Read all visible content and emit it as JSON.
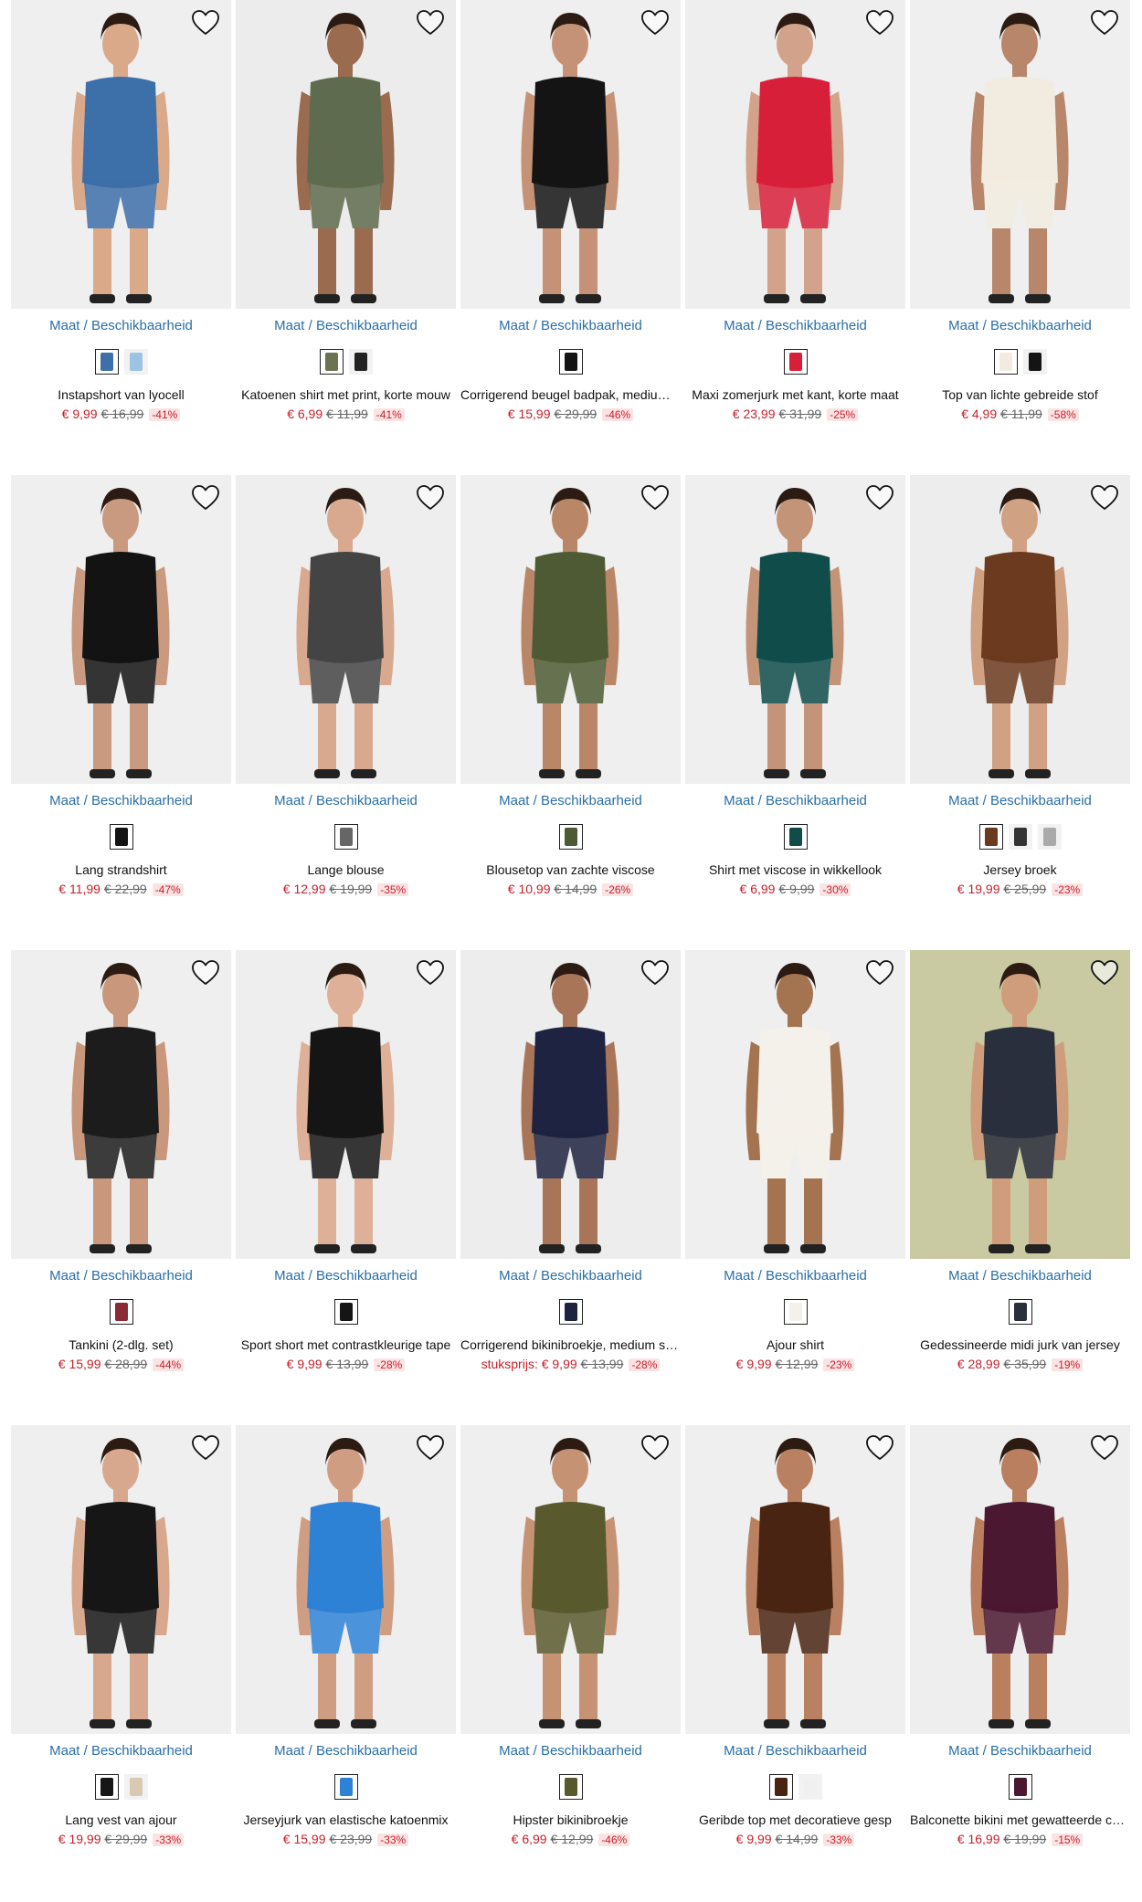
{
  "size_link_label": "Maat / Beschikbaarheid",
  "colors": {
    "accent_link": "#2a6fa6",
    "sale_red": "#c8202b",
    "badge_bg": "#fbe3e4"
  },
  "products": [
    {
      "title": "Instapshort van lyocell",
      "price": "€ 9,99",
      "old_price": "€ 16,99",
      "discount": "-41%",
      "bg": "#efefef",
      "garment": "#3d6fa8",
      "skin": "#d9a98a",
      "swatches": [
        "#3d6fa8",
        "#9cc3e3"
      ]
    },
    {
      "title": "Katoenen shirt met print, korte mouw",
      "price": "€ 6,99",
      "old_price": "€ 11,99",
      "discount": "-41%",
      "bg": "#ececec",
      "garment": "#5f6b4e",
      "skin": "#9a6b4f",
      "swatches": [
        "#6b7350",
        "#222222"
      ]
    },
    {
      "title": "Corrigerend beugel badpak, medium shaping",
      "price": "€ 15,99",
      "old_price": "€ 29,99",
      "discount": "-46%",
      "bg": "#efefef",
      "garment": "#141414",
      "skin": "#c59277",
      "swatches": [
        "#141414"
      ]
    },
    {
      "title": "Maxi zomerjurk met kant, korte maat",
      "price": "€ 23,99",
      "old_price": "€ 31,99",
      "discount": "-25%",
      "bg": "#eeeeee",
      "garment": "#d81f3a",
      "skin": "#d2a38a",
      "swatches": [
        "#d81f3a"
      ]
    },
    {
      "title": "Top van lichte gebreide stof",
      "price": "€ 4,99",
      "old_price": "€ 11,99",
      "discount": "-58%",
      "bg": "#efefef",
      "garment": "#f2ece0",
      "skin": "#b7866b",
      "swatches": [
        "#f2ece0",
        "#141414"
      ]
    },
    {
      "title": "Lang strandshirt",
      "price": "€ 11,99",
      "old_price": "€ 22,99",
      "discount": "-47%",
      "bg": "#efefef",
      "garment": "#131313",
      "skin": "#c99a80",
      "swatches": [
        "#131313"
      ]
    },
    {
      "title": "Lange blouse",
      "price": "€ 12,99",
      "old_price": "€ 19,99",
      "discount": "-35%",
      "bg": "#eeeeee",
      "garment": "#444444",
      "skin": "#d8a98f",
      "swatches": [
        "#666666"
      ]
    },
    {
      "title": "Blousetop van zachte viscose",
      "price": "€ 10,99",
      "old_price": "€ 14,99",
      "discount": "-26%",
      "bg": "#efefef",
      "garment": "#4d5a33",
      "skin": "#b98668",
      "swatches": [
        "#4d5a33"
      ]
    },
    {
      "title": "Shirt met viscose in wikkellook",
      "price": "€ 6,99",
      "old_price": "€ 9,99",
      "discount": "-30%",
      "bg": "#efefef",
      "garment": "#0f4c4a",
      "skin": "#c49478",
      "swatches": [
        "#0f4c4a"
      ]
    },
    {
      "title": "Jersey broek",
      "price": "€ 19,99",
      "old_price": "€ 25,99",
      "discount": "-23%",
      "bg": "#ededed",
      "garment": "#6b3a1f",
      "skin": "#d1a184",
      "swatches": [
        "#6b3a1f",
        "#333333",
        "#aaaaaa"
      ]
    },
    {
      "title": "Tankini (2-dlg. set)",
      "price": "€ 15,99",
      "old_price": "€ 28,99",
      "discount": "-44%",
      "bg": "#efefef",
      "garment": "#1c1c1c",
      "skin": "#c8977c",
      "swatches": [
        "#8a2a34"
      ]
    },
    {
      "title": "Sport short met contrastkleurige tape",
      "price": "€ 9,99",
      "old_price": "€ 13,99",
      "discount": "-28%",
      "bg": "#eeeeee",
      "garment": "#151515",
      "skin": "#ddb097",
      "swatches": [
        "#151515"
      ]
    },
    {
      "title": "Corrigerend bikinibroekje, medium shaping",
      "prefix": "stuksprijs:",
      "price": "€ 9,99",
      "old_price": "€ 13,99",
      "discount": "-28%",
      "bg": "#ededed",
      "garment": "#1d2340",
      "skin": "#a87559",
      "swatches": [
        "#1d2340"
      ]
    },
    {
      "title": "Ajour shirt",
      "price": "€ 9,99",
      "old_price": "€ 12,99",
      "discount": "-23%",
      "bg": "#efefef",
      "garment": "#f4f1ea",
      "skin": "#a4734f",
      "swatches": [
        "#f4f1ea"
      ]
    },
    {
      "title": "Gedessineerde midi jurk van jersey",
      "price": "€ 28,99",
      "old_price": "€ 35,99",
      "discount": "-19%",
      "bg": "#c9c9a2",
      "garment": "#2a2f3d",
      "skin": "#cf9d7c",
      "swatches": [
        "#2a2f3d"
      ]
    },
    {
      "title": "Lang vest van ajour",
      "price": "€ 19,99",
      "old_price": "€ 29,99",
      "discount": "-33%",
      "bg": "#efefef",
      "garment": "#161616",
      "skin": "#d7a88e",
      "swatches": [
        "#161616",
        "#d9c9b3"
      ]
    },
    {
      "title": "Jerseyjurk van elastische katoenmix",
      "price": "€ 15,99",
      "old_price": "€ 23,99",
      "discount": "-33%",
      "bg": "#eeeeee",
      "garment": "#2e82d6",
      "skin": "#cf9e82",
      "swatches": [
        "#2e82d6"
      ]
    },
    {
      "title": "Hipster bikinibroekje",
      "price": "€ 6,99",
      "old_price": "€ 12,99",
      "discount": "-46%",
      "bg": "#efefef",
      "garment": "#59592e",
      "skin": "#c69274",
      "swatches": [
        "#59592e"
      ]
    },
    {
      "title": "Geribde top met decoratieve gesp",
      "price": "€ 9,99",
      "old_price": "€ 14,99",
      "discount": "-33%",
      "bg": "#efefef",
      "garment": "#4a2412",
      "skin": "#b98162",
      "swatches": [
        "#4a2412",
        "#f0f0f0"
      ]
    },
    {
      "title": "Balconette bikini met gewatteerde cups",
      "price": "€ 16,99",
      "old_price": "€ 19,99",
      "discount": "-15%",
      "bg": "#eeeeee",
      "garment": "#4a1830",
      "skin": "#b97f5e",
      "swatches": [
        "#4a1830"
      ]
    }
  ]
}
